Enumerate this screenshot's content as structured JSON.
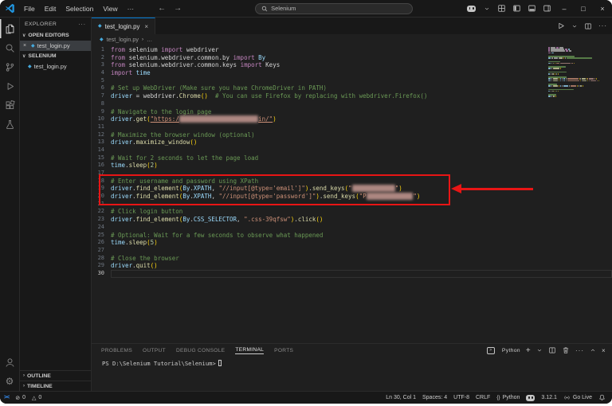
{
  "title_bar": {
    "menus": [
      "File",
      "Edit",
      "Selection",
      "View"
    ],
    "more_label": "···",
    "nav_back": "←",
    "nav_forward": "→",
    "search_value": "Selenium",
    "right_icons": [
      "copilot",
      "chevron-down",
      "layout-grid",
      "layout-sidebar-left",
      "layout-panel",
      "layout-sidebar-right"
    ],
    "window_controls": {
      "minimize": "–",
      "maximize": "□",
      "close": "×"
    }
  },
  "activity_bar": {
    "top": [
      {
        "name": "explorer",
        "active": true
      },
      {
        "name": "search",
        "active": false
      },
      {
        "name": "source-control",
        "active": false
      },
      {
        "name": "run-debug",
        "active": false
      },
      {
        "name": "extensions",
        "active": false
      },
      {
        "name": "testing",
        "active": false
      }
    ],
    "bottom": [
      {
        "name": "account",
        "active": false
      },
      {
        "name": "settings",
        "active": false
      }
    ]
  },
  "sidebar": {
    "title": "EXPLORER",
    "more": "···",
    "sections": {
      "open_editors": {
        "label": "OPEN EDITORS",
        "item": "test_login.py",
        "close": "×"
      },
      "folder": {
        "label": "SELENIUM",
        "item": "test_login.py"
      },
      "outline": "OUTLINE",
      "timeline": "TIMELINE"
    }
  },
  "editor": {
    "tab": {
      "label": "test_login.py",
      "close": "×"
    },
    "breadcrumb": {
      "file": "test_login.py",
      "sep": "›",
      "tail": "…"
    },
    "actions": [
      "run",
      "chevron-down",
      "split",
      "ellipsis"
    ],
    "code": {
      "lines": [
        [
          [
            "k",
            "from"
          ],
          [
            "p",
            " selenium "
          ],
          [
            "k",
            "import"
          ],
          [
            "p",
            " webdriver"
          ]
        ],
        [
          [
            "k",
            "from"
          ],
          [
            "p",
            " selenium.webdriver.common.by "
          ],
          [
            "k",
            "import"
          ],
          [
            "v",
            " By"
          ]
        ],
        [
          [
            "k",
            "from"
          ],
          [
            "p",
            " selenium.webdriver.common.keys "
          ],
          [
            "k",
            "import"
          ],
          [
            "p",
            " Keys"
          ]
        ],
        [
          [
            "k",
            "import"
          ],
          [
            "v",
            " time"
          ]
        ],
        [],
        [
          [
            "c",
            "# Set up WebDriver (Make sure you have ChromeDriver in PATH)"
          ]
        ],
        [
          [
            "v",
            "driver"
          ],
          [
            "p",
            " = "
          ],
          [
            "p",
            "webdriver"
          ],
          [
            "p",
            "."
          ],
          [
            "f",
            "Chrome"
          ],
          [
            "b",
            "()"
          ],
          [
            "p",
            "  "
          ],
          [
            "c",
            "# You can use Firefox by replacing with webdriver.Firefox()"
          ]
        ],
        [],
        [
          [
            "c",
            "# Navigate to the login page"
          ]
        ],
        [
          [
            "v",
            "driver"
          ],
          [
            "p",
            "."
          ],
          [
            "f",
            "get"
          ],
          [
            "b",
            "("
          ],
          [
            "sl",
            "\"https:/"
          ],
          [
            "r",
            "                      "
          ],
          [
            "sl",
            "in/\""
          ],
          [
            "b",
            ")"
          ]
        ],
        [],
        [
          [
            "c",
            "# Maximize the browser window (optional)"
          ]
        ],
        [
          [
            "v",
            "driver"
          ],
          [
            "p",
            "."
          ],
          [
            "f",
            "maximize_window"
          ],
          [
            "b",
            "()"
          ]
        ],
        [],
        [
          [
            "c",
            "# Wait for 2 seconds to let the page load"
          ]
        ],
        [
          [
            "v",
            "time"
          ],
          [
            "p",
            "."
          ],
          [
            "f",
            "sleep"
          ],
          [
            "b",
            "("
          ],
          [
            "n",
            "2"
          ],
          [
            "b",
            ")"
          ]
        ],
        [],
        [
          [
            "c",
            "# Enter username and password using XPath"
          ]
        ],
        [
          [
            "v",
            "driver"
          ],
          [
            "p",
            "."
          ],
          [
            "f",
            "find_element"
          ],
          [
            "b",
            "("
          ],
          [
            "v",
            "By"
          ],
          [
            "p",
            "."
          ],
          [
            "v",
            "XPATH"
          ],
          [
            "p",
            ", "
          ],
          [
            "s",
            "\"//input[@type='email']\""
          ],
          [
            "b",
            ")"
          ],
          [
            "p",
            "."
          ],
          [
            "f",
            "send_keys"
          ],
          [
            "b",
            "("
          ],
          [
            "s",
            "\""
          ],
          [
            "r",
            "            "
          ],
          [
            "s",
            "\""
          ],
          [
            "b",
            ")"
          ]
        ],
        [
          [
            "v",
            "driver"
          ],
          [
            "p",
            "."
          ],
          [
            "f",
            "find_element"
          ],
          [
            "b",
            "("
          ],
          [
            "v",
            "By"
          ],
          [
            "p",
            "."
          ],
          [
            "v",
            "XPATH"
          ],
          [
            "p",
            ", "
          ],
          [
            "s",
            "\"//input[@type='password']\""
          ],
          [
            "b",
            ")"
          ],
          [
            "p",
            "."
          ],
          [
            "f",
            "send_keys"
          ],
          [
            "b",
            "("
          ],
          [
            "s",
            "\"P"
          ],
          [
            "r",
            "             "
          ],
          [
            "s",
            "\""
          ],
          [
            "b",
            ")"
          ]
        ],
        [],
        [
          [
            "c",
            "# Click login button"
          ]
        ],
        [
          [
            "v",
            "driver"
          ],
          [
            "p",
            "."
          ],
          [
            "f",
            "find_element"
          ],
          [
            "b",
            "("
          ],
          [
            "v",
            "By"
          ],
          [
            "p",
            "."
          ],
          [
            "v",
            "CSS_SELECTOR"
          ],
          [
            "p",
            ", "
          ],
          [
            "s",
            "\".css-39qfsw\""
          ],
          [
            "b",
            ")"
          ],
          [
            "p",
            "."
          ],
          [
            "f",
            "click"
          ],
          [
            "b",
            "()"
          ]
        ],
        [],
        [
          [
            "c",
            "# Optional: Wait for a few seconds to observe what happened"
          ]
        ],
        [
          [
            "v",
            "time"
          ],
          [
            "p",
            "."
          ],
          [
            "f",
            "sleep"
          ],
          [
            "b",
            "("
          ],
          [
            "n",
            "5"
          ],
          [
            "b",
            ")"
          ]
        ],
        [],
        [
          [
            "c",
            "# Close the browser"
          ]
        ],
        [
          [
            "v",
            "driver"
          ],
          [
            "p",
            "."
          ],
          [
            "f",
            "quit"
          ],
          [
            "b",
            "()"
          ]
        ],
        []
      ],
      "current_line": 30
    }
  },
  "annotation": {
    "color": "#e81515"
  },
  "panel": {
    "tabs": [
      {
        "label": "PROBLEMS",
        "active": false
      },
      {
        "label": "OUTPUT",
        "active": false
      },
      {
        "label": "DEBUG CONSOLE",
        "active": false
      },
      {
        "label": "TERMINAL",
        "active": true
      },
      {
        "label": "PORTS",
        "active": false
      }
    ],
    "actions": [
      {
        "icon": "terminal-profile",
        "label": "Python"
      },
      {
        "icon": "plus",
        "label": ""
      },
      {
        "icon": "chevron-down",
        "label": ""
      },
      {
        "icon": "split",
        "label": ""
      },
      {
        "icon": "trash",
        "label": ""
      },
      {
        "icon": "ellipsis",
        "label": ""
      },
      {
        "icon": "chevron-up",
        "label": ""
      },
      {
        "icon": "close",
        "label": ""
      }
    ],
    "terminal_prompt": "PS D:\\Selenium Tutorial\\Selenium>"
  },
  "status_bar": {
    "left": [
      {
        "icon": "remote",
        "label": ""
      },
      {
        "icon": "error",
        "label": "0"
      },
      {
        "icon": "warning",
        "label": "0"
      }
    ],
    "right": [
      {
        "icon": "",
        "label": "Ln 30, Col 1"
      },
      {
        "icon": "",
        "label": "Spaces: 4"
      },
      {
        "icon": "",
        "label": "UTF-8"
      },
      {
        "icon": "",
        "label": "CRLF"
      },
      {
        "icon": "braces",
        "label": "Python"
      },
      {
        "icon": "copilot",
        "label": ""
      },
      {
        "icon": "",
        "label": "3.12.1"
      },
      {
        "icon": "broadcast",
        "label": "Go Live"
      },
      {
        "icon": "bell",
        "label": ""
      }
    ]
  },
  "colors": {
    "accent": "#0078d4",
    "annotation_red": "#e81515",
    "python_icon": "#45a9dc"
  }
}
